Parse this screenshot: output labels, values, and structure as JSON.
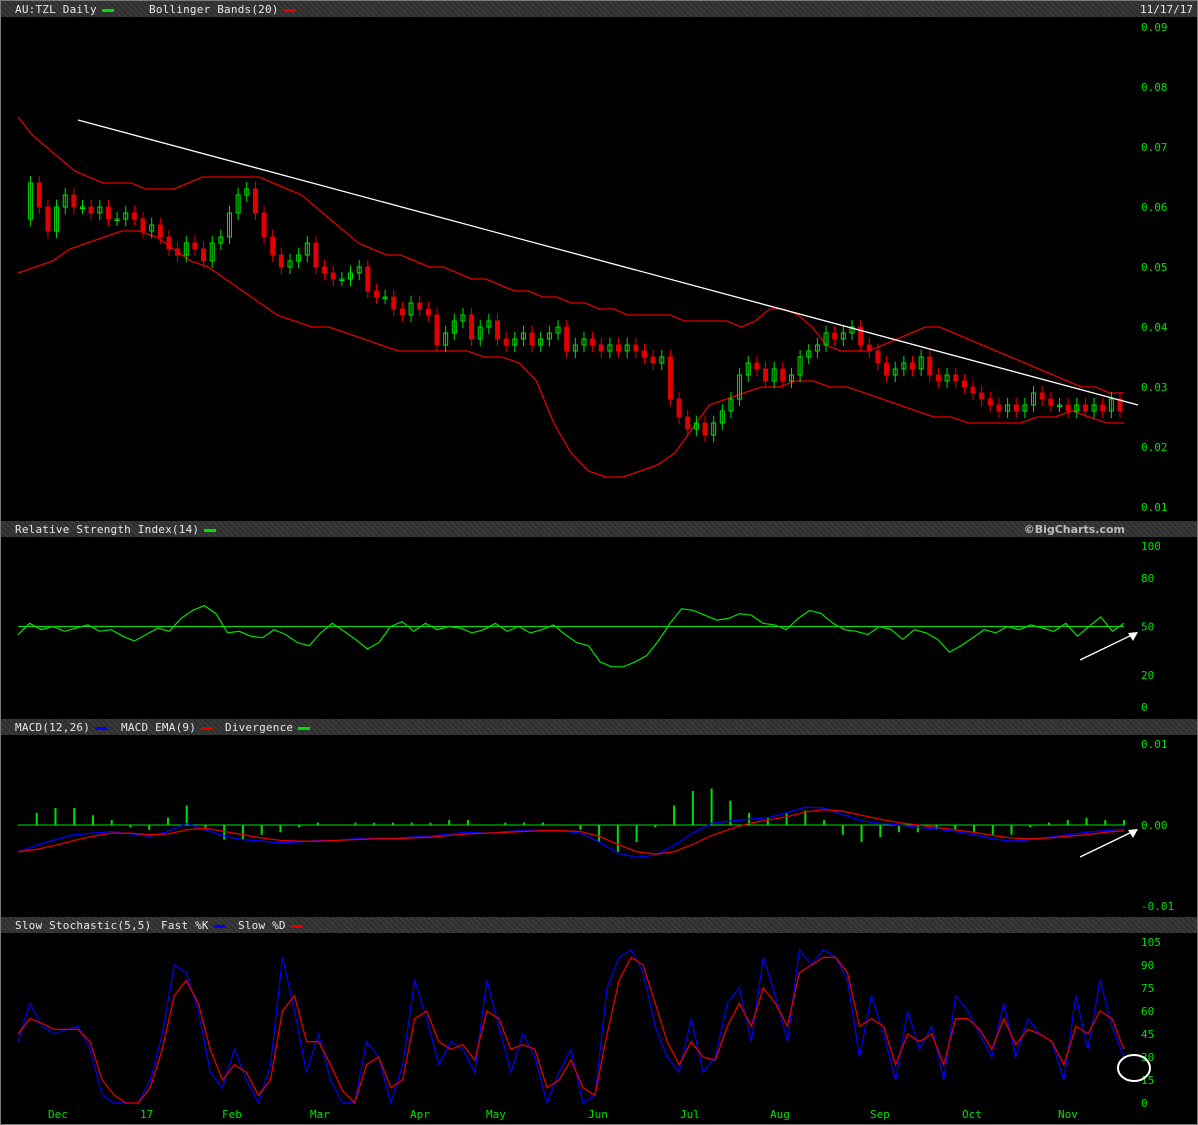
{
  "header": {
    "symbol_label": "AU:TZL Daily",
    "bollinger_label": "Bollinger Bands(20)",
    "date": "11/17/17",
    "brand": "©BigCharts.com"
  },
  "panels": {
    "rsi_label": "Relative Strength Index(14)",
    "macd_label": "MACD(12,26)",
    "macd_ema_label": "MACD EMA(9)",
    "divergence_label": "Divergence",
    "stoch_label": "Slow Stochastic(5,5)",
    "fast_label": "Fast %K",
    "slow_label": "Slow %D"
  },
  "colors": {
    "up": "#00e000",
    "down": "#e00000",
    "band": "#e00000",
    "rsi": "#00e000",
    "macd": "#0000ff",
    "signal": "#e00000",
    "trend": "#ffffff"
  },
  "chart_data": [
    {
      "type": "candlestick",
      "title": "AU:TZL Daily",
      "ylim": [
        0.01,
        0.09
      ],
      "yticks": [
        "0.09",
        "0.08",
        "0.07",
        "0.06",
        "0.05",
        "0.04",
        "0.03",
        "0.02",
        "0.01"
      ],
      "xticks": [
        "Dec",
        "17",
        "Feb",
        "Mar",
        "Apr",
        "May",
        "Jun",
        "Jul",
        "Aug",
        "Sep",
        "Oct",
        "Nov"
      ],
      "closes": [
        0.058,
        0.064,
        0.06,
        0.056,
        0.06,
        0.062,
        0.06,
        0.06,
        0.059,
        0.06,
        0.058,
        0.058,
        0.059,
        0.058,
        0.056,
        0.057,
        0.055,
        0.053,
        0.052,
        0.054,
        0.053,
        0.051,
        0.054,
        0.055,
        0.059,
        0.062,
        0.063,
        0.059,
        0.055,
        0.052,
        0.05,
        0.051,
        0.052,
        0.054,
        0.05,
        0.049,
        0.048,
        0.048,
        0.049,
        0.05,
        0.046,
        0.045,
        0.045,
        0.043,
        0.042,
        0.044,
        0.043,
        0.042,
        0.037,
        0.039,
        0.041,
        0.042,
        0.038,
        0.04,
        0.041,
        0.038,
        0.037,
        0.038,
        0.039,
        0.037,
        0.038,
        0.039,
        0.04,
        0.036,
        0.037,
        0.038,
        0.037,
        0.036,
        0.037,
        0.036,
        0.037,
        0.036,
        0.035,
        0.034,
        0.035,
        0.028,
        0.025,
        0.023,
        0.024,
        0.022,
        0.024,
        0.026,
        0.028,
        0.032,
        0.034,
        0.033,
        0.031,
        0.033,
        0.031,
        0.032,
        0.035,
        0.036,
        0.037,
        0.039,
        0.038,
        0.039,
        0.04,
        0.037,
        0.036,
        0.034,
        0.032,
        0.033,
        0.034,
        0.033,
        0.035,
        0.032,
        0.031,
        0.032,
        0.031,
        0.03,
        0.029,
        0.028,
        0.027,
        0.026,
        0.027,
        0.026,
        0.027,
        0.029,
        0.028,
        0.027,
        0.027,
        0.026,
        0.027,
        0.026,
        0.027,
        0.026,
        0.028,
        0.026
      ],
      "upper_band": [
        0.075,
        0.072,
        0.07,
        0.068,
        0.066,
        0.065,
        0.064,
        0.064,
        0.064,
        0.063,
        0.063,
        0.063,
        0.064,
        0.065,
        0.065,
        0.065,
        0.065,
        0.065,
        0.064,
        0.063,
        0.062,
        0.06,
        0.058,
        0.056,
        0.054,
        0.053,
        0.052,
        0.052,
        0.051,
        0.05,
        0.05,
        0.049,
        0.048,
        0.048,
        0.047,
        0.046,
        0.046,
        0.045,
        0.045,
        0.044,
        0.044,
        0.043,
        0.043,
        0.042,
        0.042,
        0.042,
        0.042,
        0.041,
        0.041,
        0.041,
        0.041,
        0.04,
        0.041,
        0.043,
        0.043,
        0.042,
        0.04,
        0.037,
        0.036,
        0.036,
        0.036,
        0.037,
        0.038,
        0.039,
        0.04,
        0.04,
        0.039,
        0.038,
        0.037,
        0.036,
        0.035,
        0.034,
        0.033,
        0.032,
        0.031,
        0.03,
        0.03,
        0.029,
        0.029
      ],
      "lower_band": [
        0.049,
        0.05,
        0.051,
        0.053,
        0.054,
        0.055,
        0.056,
        0.056,
        0.055,
        0.053,
        0.051,
        0.05,
        0.048,
        0.046,
        0.044,
        0.042,
        0.041,
        0.04,
        0.04,
        0.039,
        0.038,
        0.037,
        0.036,
        0.036,
        0.036,
        0.036,
        0.036,
        0.035,
        0.035,
        0.034,
        0.031,
        0.024,
        0.019,
        0.016,
        0.015,
        0.015,
        0.016,
        0.017,
        0.019,
        0.023,
        0.027,
        0.028,
        0.029,
        0.03,
        0.03,
        0.031,
        0.031,
        0.03,
        0.03,
        0.029,
        0.028,
        0.027,
        0.026,
        0.025,
        0.025,
        0.024,
        0.024,
        0.024,
        0.024,
        0.025,
        0.025,
        0.026,
        0.025,
        0.024,
        0.024
      ]
    },
    {
      "type": "line",
      "title": "Relative Strength Index(14)",
      "ylim": [
        0,
        100
      ],
      "yticks": [
        "100",
        "80",
        "50",
        "20",
        "0"
      ],
      "reference": 50,
      "values": [
        45,
        52,
        48,
        50,
        47,
        49,
        51,
        47,
        48,
        44,
        41,
        45,
        49,
        47,
        55,
        60,
        63,
        58,
        46,
        47,
        44,
        43,
        48,
        45,
        40,
        38,
        46,
        52,
        47,
        42,
        36,
        40,
        50,
        53,
        47,
        52,
        48,
        50,
        49,
        46,
        48,
        52,
        47,
        50,
        46,
        48,
        51,
        45,
        40,
        38,
        28,
        25,
        25,
        28,
        32,
        41,
        52,
        61,
        60,
        57,
        54,
        55,
        58,
        57,
        52,
        51,
        48,
        55,
        60,
        58,
        52,
        48,
        47,
        45,
        50,
        48,
        42,
        48,
        46,
        42,
        34,
        38,
        43,
        48,
        46,
        50,
        48,
        51,
        49,
        47,
        52,
        44,
        50,
        56,
        47,
        52
      ]
    },
    {
      "type": "line",
      "title": "MACD(12,26)",
      "ylim": [
        -0.01,
        0.01
      ],
      "yticks": [
        "0.01",
        "0.00",
        "-0.01"
      ],
      "series": [
        {
          "name": "MACD(12,26)",
          "values": [
            -0.0033,
            -0.0025,
            -0.0018,
            -0.0012,
            -0.001,
            -0.0008,
            -0.0011,
            -0.0014,
            -0.0008,
            0.0002,
            -0.0006,
            -0.0014,
            -0.0018,
            -0.002,
            -0.0022,
            -0.0021,
            -0.0019,
            -0.0019,
            -0.0017,
            -0.0016,
            -0.0016,
            -0.0015,
            -0.0014,
            -0.0011,
            -0.0009,
            -0.001,
            -0.0008,
            -0.0007,
            -0.0006,
            -0.0007,
            -0.001,
            -0.0021,
            -0.0035,
            -0.004,
            -0.0037,
            -0.0025,
            -0.001,
            0.0002,
            0.0005,
            0.0007,
            0.0009,
            0.0015,
            0.0022,
            0.0021,
            0.0013,
            0.0005,
            0.0002,
            0.0,
            -0.0003,
            -0.0005,
            -0.0008,
            -0.0012,
            -0.0017,
            -0.002,
            -0.0018,
            -0.0015,
            -0.0012,
            -0.0009,
            -0.0007,
            -0.0005
          ]
        },
        {
          "name": "MACD EMA(9)",
          "values": [
            -0.0033,
            -0.003,
            -0.0025,
            -0.0019,
            -0.0014,
            -0.001,
            -0.001,
            -0.0012,
            -0.0011,
            -0.0006,
            -0.0004,
            -0.0008,
            -0.0012,
            -0.0016,
            -0.0019,
            -0.002,
            -0.002,
            -0.0019,
            -0.0018,
            -0.0017,
            -0.0017,
            -0.0016,
            -0.0015,
            -0.0013,
            -0.0011,
            -0.001,
            -0.0009,
            -0.0008,
            -0.0007,
            -0.0007,
            -0.0008,
            -0.0014,
            -0.0024,
            -0.0033,
            -0.0036,
            -0.0033,
            -0.0024,
            -0.0013,
            -0.0005,
            0.0002,
            0.0006,
            0.001,
            0.0016,
            0.0019,
            0.0017,
            0.0012,
            0.0007,
            0.0003,
            0.0,
            -0.0003,
            -0.0006,
            -0.0009,
            -0.0013,
            -0.0016,
            -0.0017,
            -0.0016,
            -0.0014,
            -0.0012,
            -0.0009,
            -0.0007
          ]
        }
      ]
    },
    {
      "type": "line",
      "title": "Slow Stochastic(5,5)",
      "ylim": [
        0,
        105
      ],
      "yticks": [
        "105",
        "90",
        "75",
        "60",
        "45",
        "30",
        "15",
        "0"
      ],
      "series": [
        {
          "name": "Fast %K",
          "values": [
            40,
            65,
            50,
            45,
            48,
            50,
            35,
            5,
            0,
            0,
            0,
            15,
            45,
            90,
            85,
            60,
            20,
            10,
            35,
            15,
            0,
            25,
            95,
            60,
            20,
            45,
            15,
            0,
            0,
            40,
            30,
            0,
            25,
            80,
            55,
            25,
            40,
            35,
            20,
            80,
            50,
            20,
            45,
            30,
            0,
            20,
            35,
            0,
            5,
            75,
            95,
            100,
            85,
            50,
            30,
            20,
            55,
            20,
            30,
            65,
            75,
            40,
            95,
            70,
            40,
            100,
            90,
            100,
            95,
            80,
            30,
            70,
            45,
            15,
            60,
            35,
            50,
            15,
            70,
            60,
            45,
            30,
            65,
            30,
            55,
            45,
            40,
            15,
            70,
            35,
            80,
            50,
            30
          ]
        },
        {
          "name": "Slow %D",
          "values": [
            45,
            55,
            52,
            48,
            48,
            48,
            40,
            15,
            5,
            0,
            0,
            10,
            35,
            70,
            80,
            65,
            35,
            15,
            25,
            20,
            5,
            15,
            60,
            70,
            40,
            40,
            25,
            8,
            0,
            25,
            30,
            10,
            15,
            55,
            60,
            40,
            35,
            38,
            28,
            60,
            55,
            35,
            38,
            35,
            10,
            15,
            28,
            10,
            5,
            45,
            80,
            95,
            90,
            65,
            40,
            25,
            40,
            30,
            28,
            50,
            65,
            50,
            75,
            65,
            50,
            85,
            90,
            95,
            95,
            85,
            50,
            55,
            50,
            25,
            45,
            40,
            45,
            25,
            55,
            55,
            48,
            35,
            55,
            38,
            48,
            45,
            40,
            25,
            50,
            45,
            60,
            55,
            35
          ]
        }
      ]
    }
  ]
}
